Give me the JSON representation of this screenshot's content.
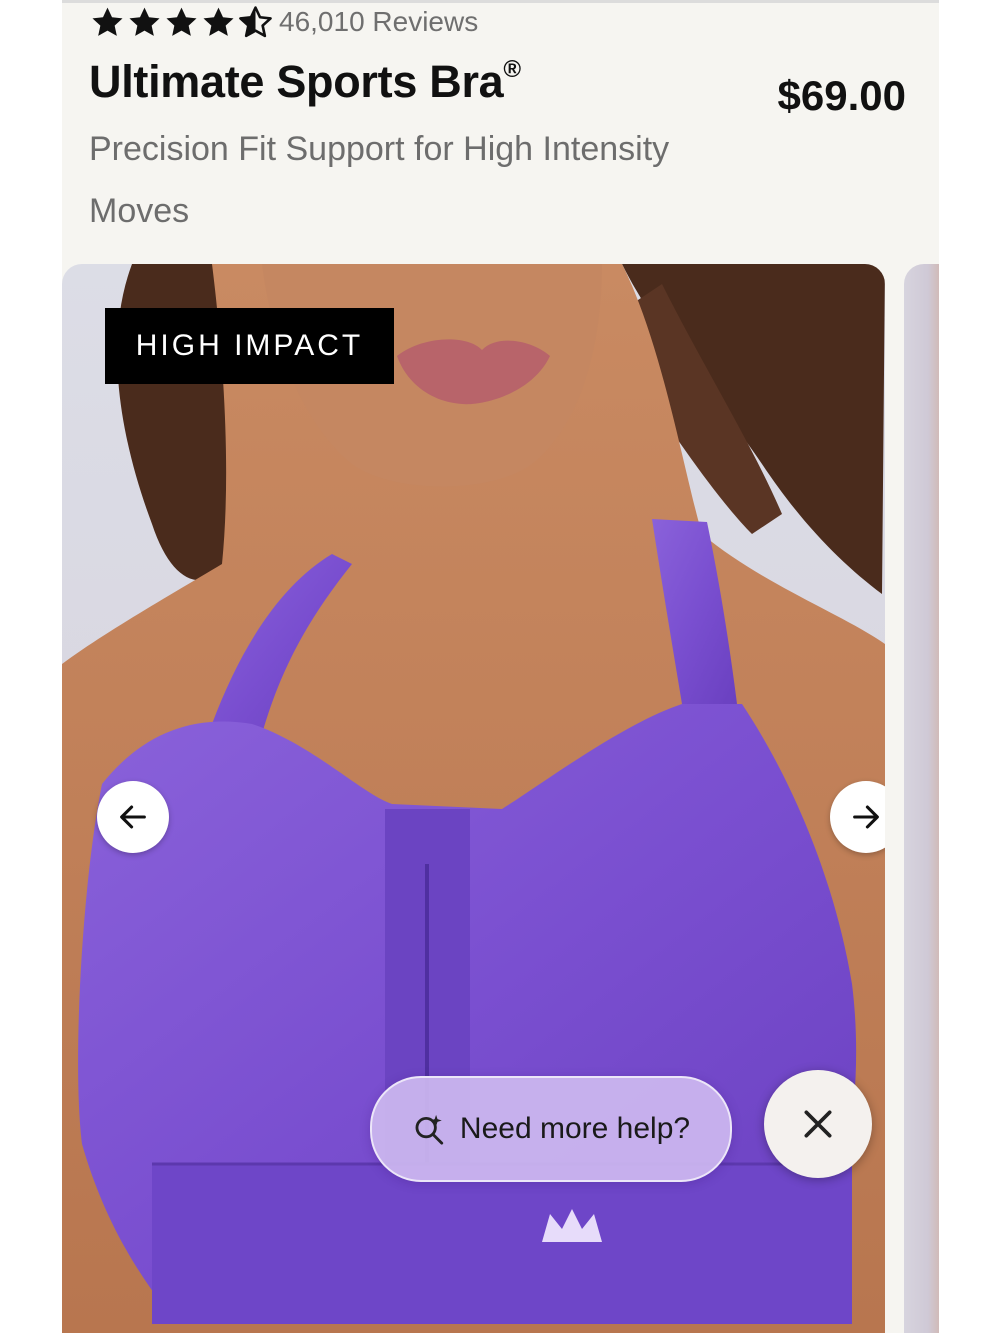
{
  "product": {
    "rating": 4.5,
    "review_count_text": "46,010 Reviews",
    "name": "Ultimate Sports Bra",
    "trademark": "®",
    "price": "$69.00",
    "subtitle": "Precision Fit Support for High Intensity Moves"
  },
  "gallery": {
    "badge": "HIGH IMPACT",
    "prev_icon": "arrow-left-icon",
    "next_icon": "arrow-right-icon",
    "garment_color": "#7a4fd0",
    "skin_color": "#c98a62",
    "hair_color": "#4a2b1c"
  },
  "help": {
    "label": "Need more help?",
    "icon": "sparkle-search-icon",
    "close_icon": "close-icon",
    "accent": "#cdb9f0"
  }
}
